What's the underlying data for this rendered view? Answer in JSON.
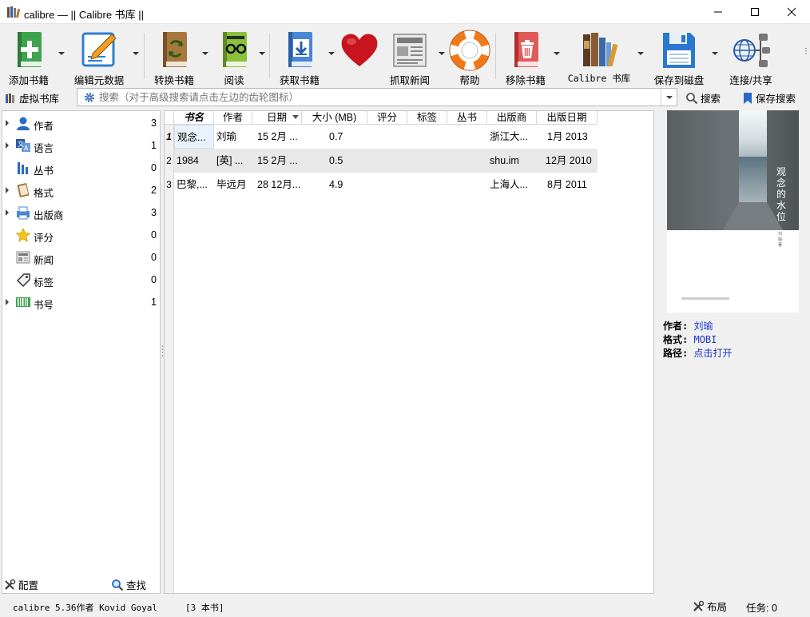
{
  "window": {
    "title": "calibre — || Calibre 书库 ||"
  },
  "toolbar": {
    "buttons": [
      {
        "label": "添加书籍",
        "icon": "add-book-icon"
      },
      {
        "label": "编辑元数据",
        "icon": "edit-metadata-icon"
      },
      {
        "label": "转换书籍",
        "icon": "convert-book-icon"
      },
      {
        "label": "阅读",
        "icon": "read-book-icon"
      },
      {
        "label": "获取书籍",
        "icon": "get-books-icon"
      },
      {
        "label": "",
        "icon": "donate-heart-icon"
      },
      {
        "label": "抓取新闻",
        "icon": "fetch-news-icon"
      },
      {
        "label": "帮助",
        "icon": "help-lifebuoy-icon"
      },
      {
        "label": "移除书籍",
        "icon": "remove-book-icon"
      },
      {
        "label": "Calibre 书库",
        "icon": "calibre-library-icon"
      },
      {
        "label": "保存到磁盘",
        "icon": "save-disk-icon"
      },
      {
        "label": "连接/共享",
        "icon": "connect-share-icon"
      }
    ]
  },
  "searchbar": {
    "virtual_library": "虚拟书库",
    "placeholder": "搜索（对于高级搜索请点击左边的齿轮图标）",
    "search_label": "搜索",
    "save_search_label": "保存搜索"
  },
  "tag_browser": {
    "items": [
      {
        "label": "作者",
        "count": "3",
        "expandable": true,
        "icon": "authors-icon"
      },
      {
        "label": "语言",
        "count": "1",
        "expandable": true,
        "icon": "languages-icon"
      },
      {
        "label": "丛书",
        "count": "0",
        "expandable": false,
        "icon": "series-icon"
      },
      {
        "label": "格式",
        "count": "2",
        "expandable": true,
        "icon": "formats-icon"
      },
      {
        "label": "出版商",
        "count": "3",
        "expandable": true,
        "icon": "publisher-icon"
      },
      {
        "label": "评分",
        "count": "0",
        "expandable": false,
        "icon": "rating-star-icon"
      },
      {
        "label": "新闻",
        "count": "0",
        "expandable": false,
        "icon": "news-icon"
      },
      {
        "label": "标签",
        "count": "0",
        "expandable": false,
        "icon": "tags-icon"
      },
      {
        "label": "书号",
        "count": "1",
        "expandable": true,
        "icon": "isbn-barcode-icon"
      }
    ],
    "configure_label": "配置",
    "find_label": "查找"
  },
  "book_list": {
    "columns": [
      "书名",
      "作者",
      "日期",
      "大小 (MB)",
      "评分",
      "标签",
      "丛书",
      "出版商",
      "出版日期"
    ],
    "rows": [
      {
        "num": "1",
        "title": "观念...",
        "author": "刘瑜",
        "date": "15 2月 ...",
        "size": "0.7",
        "rating": "",
        "tags": "",
        "series": "",
        "publisher": "浙江大...",
        "pubdate": "1月 2013"
      },
      {
        "num": "2",
        "title": "1984",
        "author": "[英] ...",
        "date": "15 2月 ...",
        "size": "0.5",
        "rating": "",
        "tags": "",
        "series": "",
        "publisher": "shu.im",
        "pubdate": "12月 2010"
      },
      {
        "num": "3",
        "title": "巴黎,...",
        "author": "毕远月",
        "date": "28 12月...",
        "size": "4.9",
        "rating": "",
        "tags": "",
        "series": "",
        "publisher": "上海人...",
        "pubdate": "8月 2011"
      }
    ]
  },
  "book_details": {
    "cover_title": "观念的水位",
    "cover_author": "刘瑜·著",
    "author_key": "作者:",
    "author_value": "刘瑜",
    "format_key": "格式:",
    "format_value": "MOBI",
    "path_key": "路径:",
    "path_value": "点击打开"
  },
  "statusbar": {
    "version": "calibre 5.36作者 Kovid Goyal",
    "book_count": "[3 本书]",
    "layout_label": "布局",
    "jobs_label": "任务: 0"
  }
}
